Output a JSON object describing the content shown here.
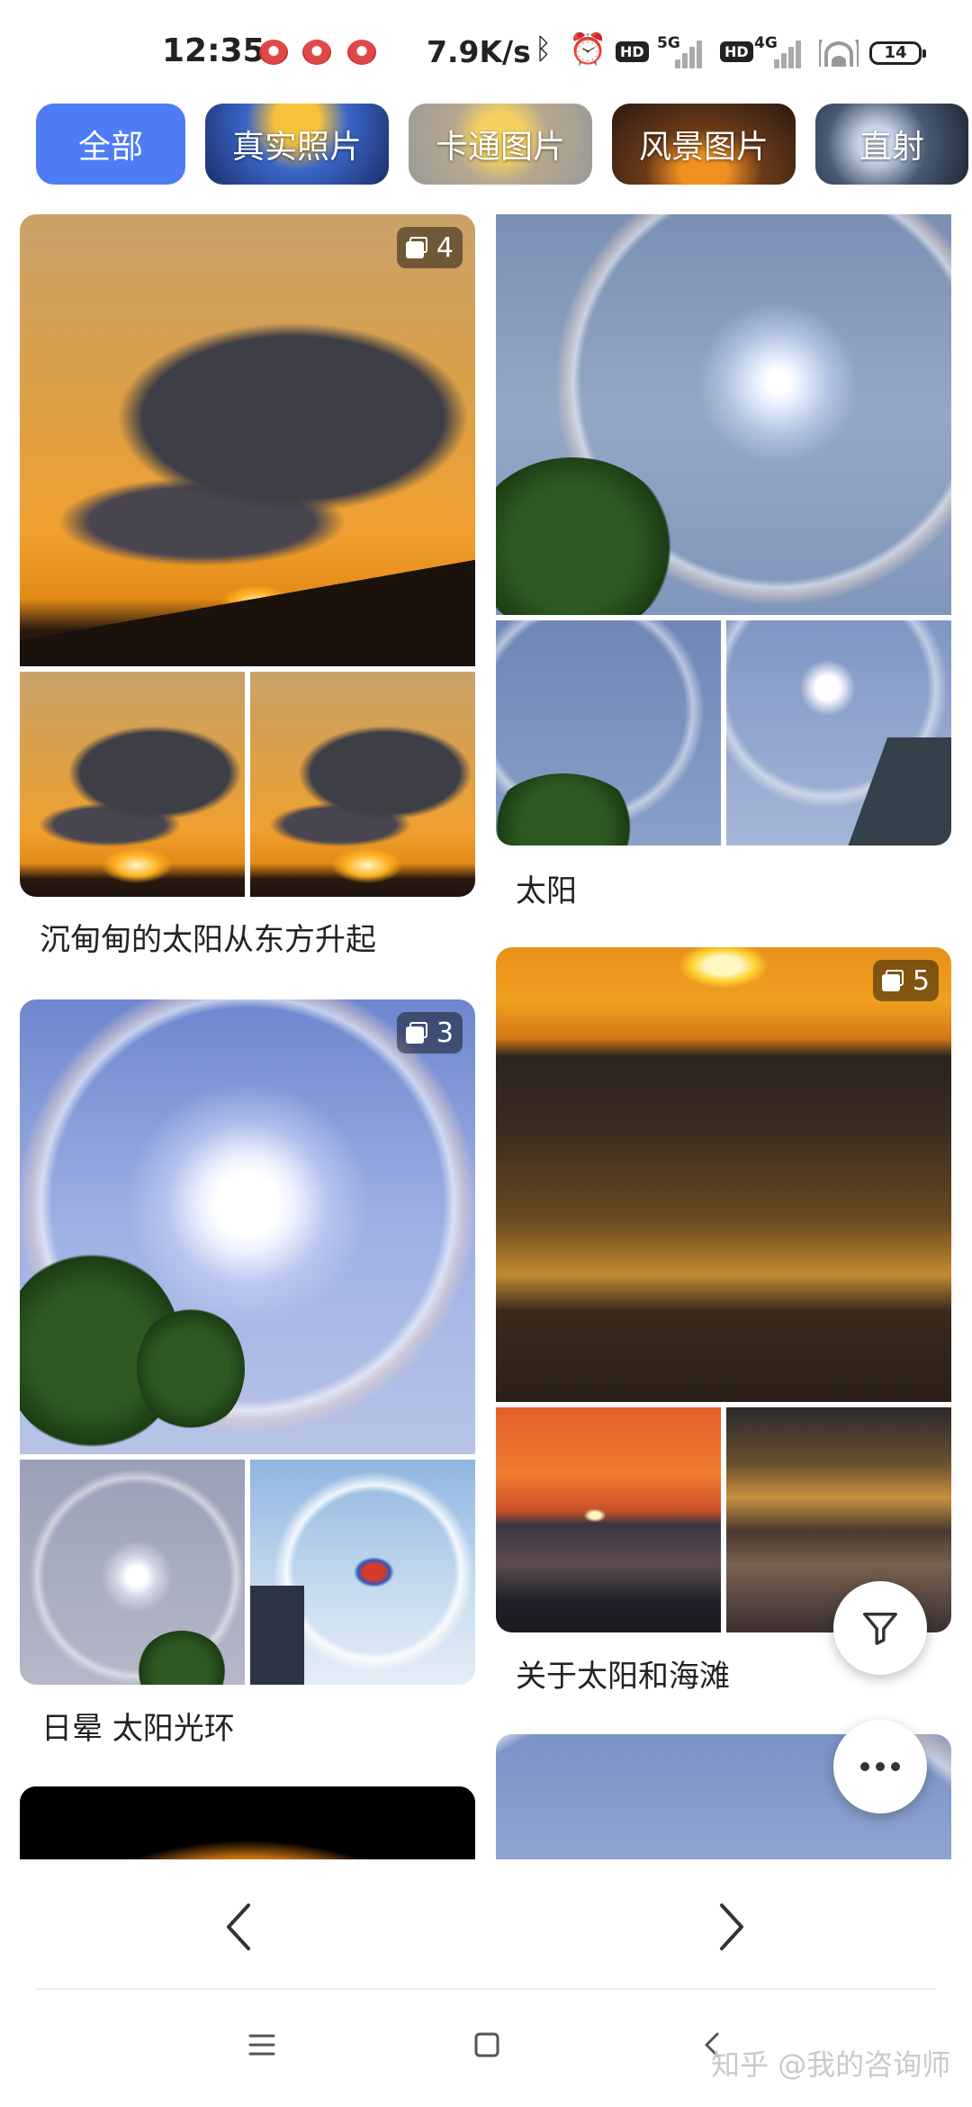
{
  "status_bar": {
    "time": "12:35",
    "network_speed": "7.9K/s",
    "signal1_label": "5G",
    "signal2_label": "4G",
    "hd1": "HD",
    "hd2": "HD",
    "battery": "14"
  },
  "categories": [
    {
      "label": "全部",
      "active": true
    },
    {
      "label": "真实照片",
      "active": false
    },
    {
      "label": "卡通图片",
      "active": false
    },
    {
      "label": "风景图片",
      "active": false
    },
    {
      "label": "直射",
      "active": false
    }
  ],
  "left_column": [
    {
      "caption": "沉甸甸的太阳从东方升起",
      "image_count": "4"
    },
    {
      "caption": "日晕 太阳光环",
      "image_count": "3"
    }
  ],
  "right_column": [
    {
      "caption": "太阳",
      "image_count": ""
    },
    {
      "caption": "关于太阳和海滩",
      "image_count": "5"
    }
  ],
  "icons": {
    "filter": "filter-icon",
    "more": "more-dots-icon",
    "prev": "chevron-left-icon",
    "next": "chevron-right-icon",
    "menu": "menu-icon",
    "home": "home-icon",
    "back": "back-icon",
    "gallery": "image-stack-icon"
  },
  "watermark": "知乎 @我的咨询师",
  "colors": {
    "accent": "#4d7cf5",
    "background": "#ffffff"
  }
}
